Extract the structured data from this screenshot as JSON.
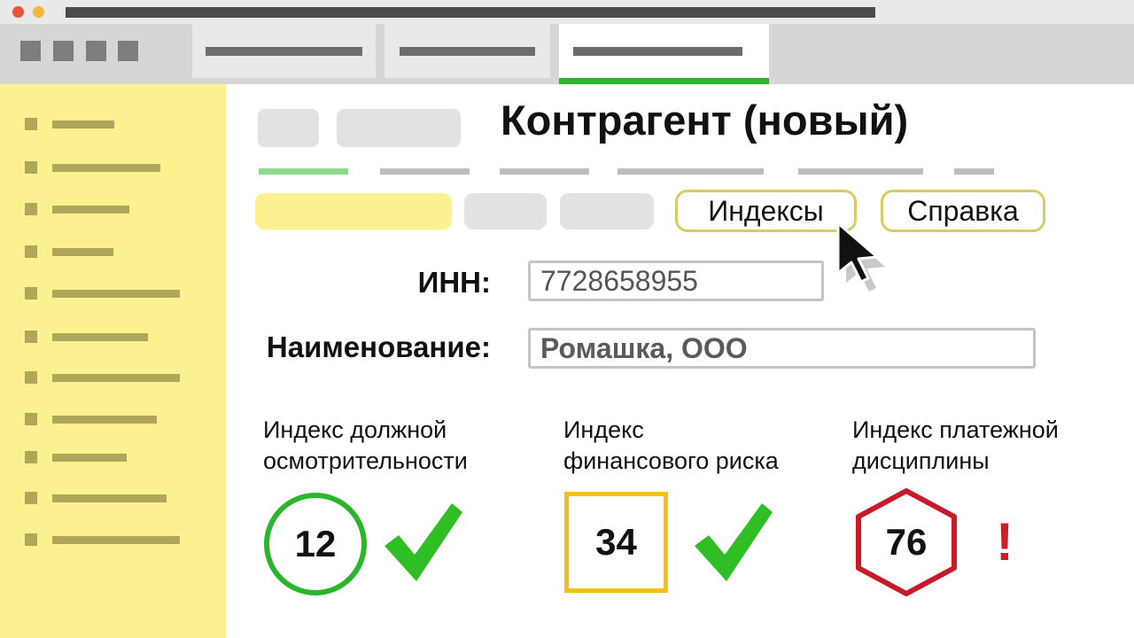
{
  "window": {
    "buttons": [
      "close",
      "minimize"
    ],
    "colors": {
      "close": "#e5553d",
      "minimize": "#f3b63a",
      "tab_active_underline": "#2bb52b",
      "sidebar": "#fcf190",
      "button_border": "#d6cc62"
    }
  },
  "page": {
    "title": "Контрагент (новый)"
  },
  "toolbar": {
    "indexes_label": "Индексы",
    "help_label": "Справка"
  },
  "form": {
    "inn_label": "ИНН:",
    "inn_value": "7728658955",
    "name_label": "Наименование:",
    "name_value": "Ромашка, ООО"
  },
  "indices": [
    {
      "caption_line1": "Индекс должной",
      "caption_line2": "осмотрительности",
      "value": "12",
      "shape": "circle",
      "color": "#2bb52b",
      "status_icon": "check-icon"
    },
    {
      "caption_line1": "Индекс",
      "caption_line2": "финансового риска",
      "value": "34",
      "shape": "square",
      "color": "#f1c215",
      "status_icon": "check-icon"
    },
    {
      "caption_line1": "Индекс платежной",
      "caption_line2": "дисциплины",
      "value": "76",
      "shape": "hexagon",
      "color": "#c81a28",
      "status_icon": "exclamation-icon",
      "status_text": "!"
    }
  ]
}
